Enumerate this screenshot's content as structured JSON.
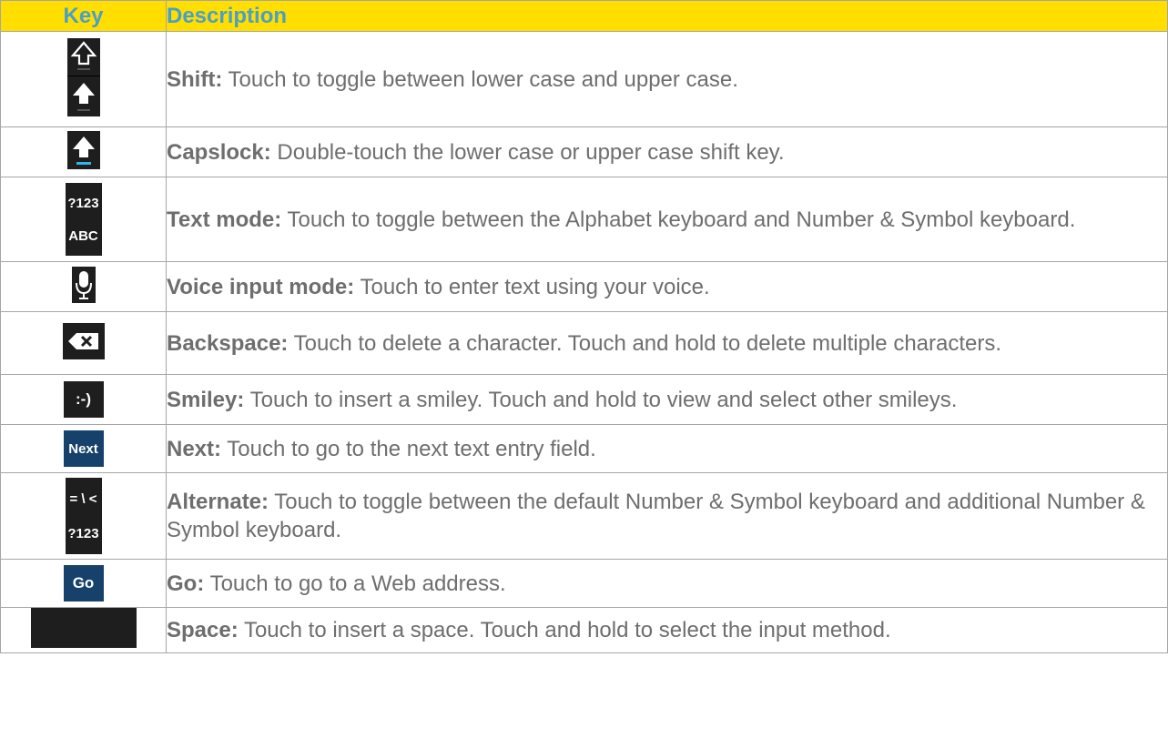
{
  "header": {
    "key": "Key",
    "description": "Description"
  },
  "rows": [
    {
      "icon": "shift-icon",
      "term": "Shift:",
      "desc": " Touch to toggle between lower case and upper case."
    },
    {
      "icon": "capslock-icon",
      "term": "Capslock:",
      "desc": " Double-touch the lower case or upper case shift key."
    },
    {
      "icon": "text-mode-icon",
      "key_labels": [
        "?123",
        "ABC"
      ],
      "term": "Text mode:",
      "desc": " Touch to toggle between the Alphabet keyboard and Number & Symbol keyboard."
    },
    {
      "icon": "microphone-icon",
      "term": "Voice input mode:",
      "desc": " Touch to enter text using your voice."
    },
    {
      "icon": "backspace-icon",
      "term": "Backspace:",
      "desc": " Touch to delete a character. Touch and hold to delete multiple characters."
    },
    {
      "icon": "smiley-icon",
      "key_label": ":-)",
      "term": "Smiley:",
      "desc": " Touch to insert a smiley. Touch and hold to view and select other smileys."
    },
    {
      "icon": "next-key-icon",
      "key_label": "Next",
      "term": "Next:",
      "desc": " Touch to go to the next text entry field."
    },
    {
      "icon": "alternate-icon",
      "key_labels": [
        "= \\ <",
        "?123"
      ],
      "term": "Alternate:",
      "desc": " Touch to toggle between the default Number & Symbol keyboard and additional Number & Symbol keyboard."
    },
    {
      "icon": "go-key-icon",
      "key_label": "Go",
      "term": "Go:",
      "desc": " Touch to go to a Web address."
    },
    {
      "icon": "space-key-icon",
      "term": "Space:",
      "desc": " Touch to insert a space. Touch and hold to select the input method."
    }
  ],
  "colors": {
    "header_bg": "#ffde00",
    "header_text": "#4a9fc8",
    "body_text": "#6e6e6e",
    "key_bg": "#1e1e1e",
    "action_key_bg": "#16416b",
    "caps_indicator": "#33b5e5"
  }
}
